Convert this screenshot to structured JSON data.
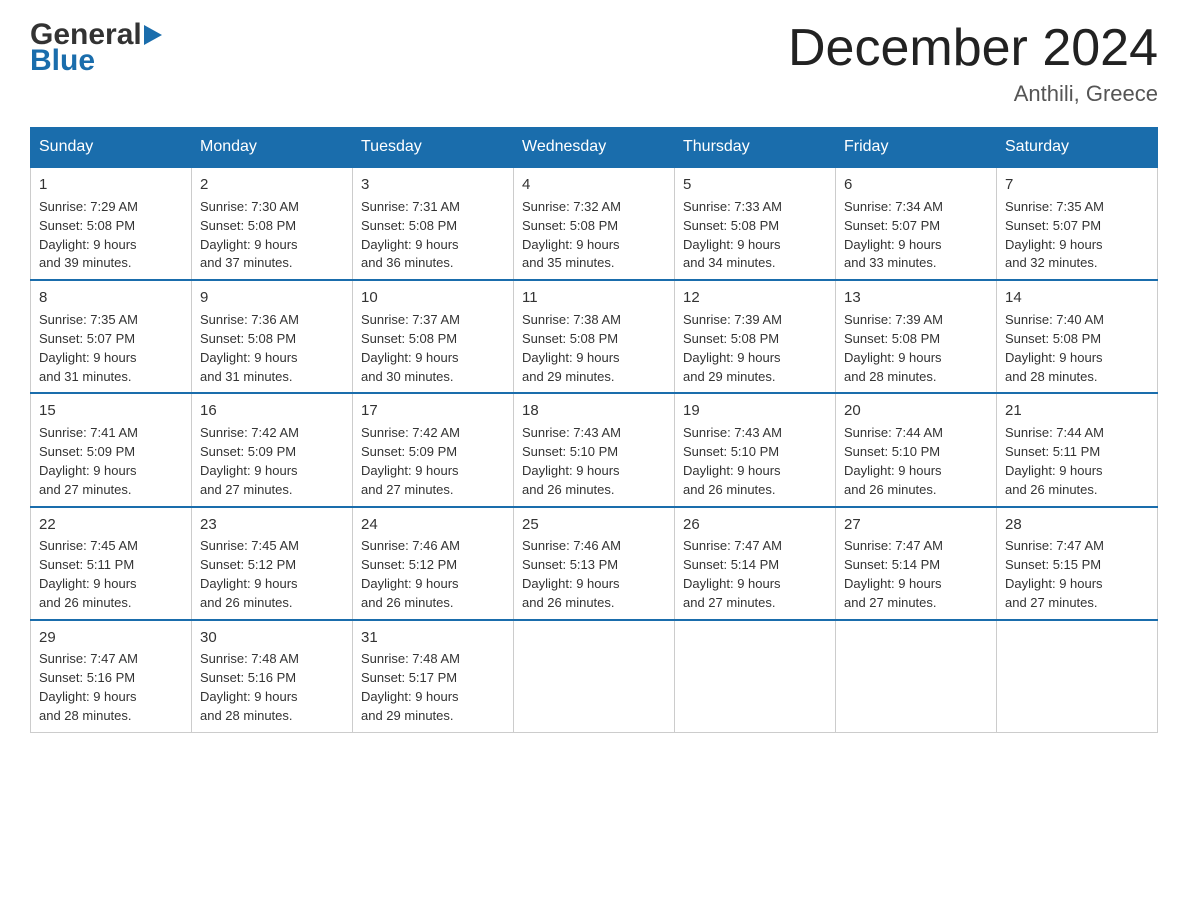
{
  "header": {
    "logo_general": "General",
    "logo_blue": "Blue",
    "title": "December 2024",
    "subtitle": "Anthili, Greece"
  },
  "weekdays": [
    "Sunday",
    "Monday",
    "Tuesday",
    "Wednesday",
    "Thursday",
    "Friday",
    "Saturday"
  ],
  "weeks": [
    [
      {
        "day": "1",
        "sunrise": "7:29 AM",
        "sunset": "5:08 PM",
        "daylight": "9 hours and 39 minutes."
      },
      {
        "day": "2",
        "sunrise": "7:30 AM",
        "sunset": "5:08 PM",
        "daylight": "9 hours and 37 minutes."
      },
      {
        "day": "3",
        "sunrise": "7:31 AM",
        "sunset": "5:08 PM",
        "daylight": "9 hours and 36 minutes."
      },
      {
        "day": "4",
        "sunrise": "7:32 AM",
        "sunset": "5:08 PM",
        "daylight": "9 hours and 35 minutes."
      },
      {
        "day": "5",
        "sunrise": "7:33 AM",
        "sunset": "5:08 PM",
        "daylight": "9 hours and 34 minutes."
      },
      {
        "day": "6",
        "sunrise": "7:34 AM",
        "sunset": "5:07 PM",
        "daylight": "9 hours and 33 minutes."
      },
      {
        "day": "7",
        "sunrise": "7:35 AM",
        "sunset": "5:07 PM",
        "daylight": "9 hours and 32 minutes."
      }
    ],
    [
      {
        "day": "8",
        "sunrise": "7:35 AM",
        "sunset": "5:07 PM",
        "daylight": "9 hours and 31 minutes."
      },
      {
        "day": "9",
        "sunrise": "7:36 AM",
        "sunset": "5:08 PM",
        "daylight": "9 hours and 31 minutes."
      },
      {
        "day": "10",
        "sunrise": "7:37 AM",
        "sunset": "5:08 PM",
        "daylight": "9 hours and 30 minutes."
      },
      {
        "day": "11",
        "sunrise": "7:38 AM",
        "sunset": "5:08 PM",
        "daylight": "9 hours and 29 minutes."
      },
      {
        "day": "12",
        "sunrise": "7:39 AM",
        "sunset": "5:08 PM",
        "daylight": "9 hours and 29 minutes."
      },
      {
        "day": "13",
        "sunrise": "7:39 AM",
        "sunset": "5:08 PM",
        "daylight": "9 hours and 28 minutes."
      },
      {
        "day": "14",
        "sunrise": "7:40 AM",
        "sunset": "5:08 PM",
        "daylight": "9 hours and 28 minutes."
      }
    ],
    [
      {
        "day": "15",
        "sunrise": "7:41 AM",
        "sunset": "5:09 PM",
        "daylight": "9 hours and 27 minutes."
      },
      {
        "day": "16",
        "sunrise": "7:42 AM",
        "sunset": "5:09 PM",
        "daylight": "9 hours and 27 minutes."
      },
      {
        "day": "17",
        "sunrise": "7:42 AM",
        "sunset": "5:09 PM",
        "daylight": "9 hours and 27 minutes."
      },
      {
        "day": "18",
        "sunrise": "7:43 AM",
        "sunset": "5:10 PM",
        "daylight": "9 hours and 26 minutes."
      },
      {
        "day": "19",
        "sunrise": "7:43 AM",
        "sunset": "5:10 PM",
        "daylight": "9 hours and 26 minutes."
      },
      {
        "day": "20",
        "sunrise": "7:44 AM",
        "sunset": "5:10 PM",
        "daylight": "9 hours and 26 minutes."
      },
      {
        "day": "21",
        "sunrise": "7:44 AM",
        "sunset": "5:11 PM",
        "daylight": "9 hours and 26 minutes."
      }
    ],
    [
      {
        "day": "22",
        "sunrise": "7:45 AM",
        "sunset": "5:11 PM",
        "daylight": "9 hours and 26 minutes."
      },
      {
        "day": "23",
        "sunrise": "7:45 AM",
        "sunset": "5:12 PM",
        "daylight": "9 hours and 26 minutes."
      },
      {
        "day": "24",
        "sunrise": "7:46 AM",
        "sunset": "5:12 PM",
        "daylight": "9 hours and 26 minutes."
      },
      {
        "day": "25",
        "sunrise": "7:46 AM",
        "sunset": "5:13 PM",
        "daylight": "9 hours and 26 minutes."
      },
      {
        "day": "26",
        "sunrise": "7:47 AM",
        "sunset": "5:14 PM",
        "daylight": "9 hours and 27 minutes."
      },
      {
        "day": "27",
        "sunrise": "7:47 AM",
        "sunset": "5:14 PM",
        "daylight": "9 hours and 27 minutes."
      },
      {
        "day": "28",
        "sunrise": "7:47 AM",
        "sunset": "5:15 PM",
        "daylight": "9 hours and 27 minutes."
      }
    ],
    [
      {
        "day": "29",
        "sunrise": "7:47 AM",
        "sunset": "5:16 PM",
        "daylight": "9 hours and 28 minutes."
      },
      {
        "day": "30",
        "sunrise": "7:48 AM",
        "sunset": "5:16 PM",
        "daylight": "9 hours and 28 minutes."
      },
      {
        "day": "31",
        "sunrise": "7:48 AM",
        "sunset": "5:17 PM",
        "daylight": "9 hours and 29 minutes."
      },
      null,
      null,
      null,
      null
    ]
  ],
  "labels": {
    "sunrise": "Sunrise:",
    "sunset": "Sunset:",
    "daylight": "Daylight:"
  }
}
